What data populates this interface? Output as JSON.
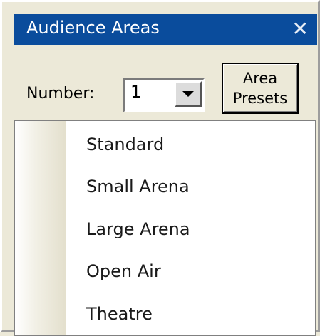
{
  "window": {
    "title": "Audience Areas",
    "close_icon": "close-icon"
  },
  "number": {
    "label": "Number:",
    "value": "1"
  },
  "presets_button": {
    "line1": "Area",
    "line2": "Presets"
  },
  "menu": {
    "items": [
      {
        "label": "Standard"
      },
      {
        "label": "Small Arena"
      },
      {
        "label": "Large Arena"
      },
      {
        "label": "Open Air"
      },
      {
        "label": "Theatre"
      }
    ]
  },
  "colors": {
    "titlebar": "#0a4c9c",
    "panel": "#ece9d8",
    "menu_bg": "#ffffff"
  }
}
